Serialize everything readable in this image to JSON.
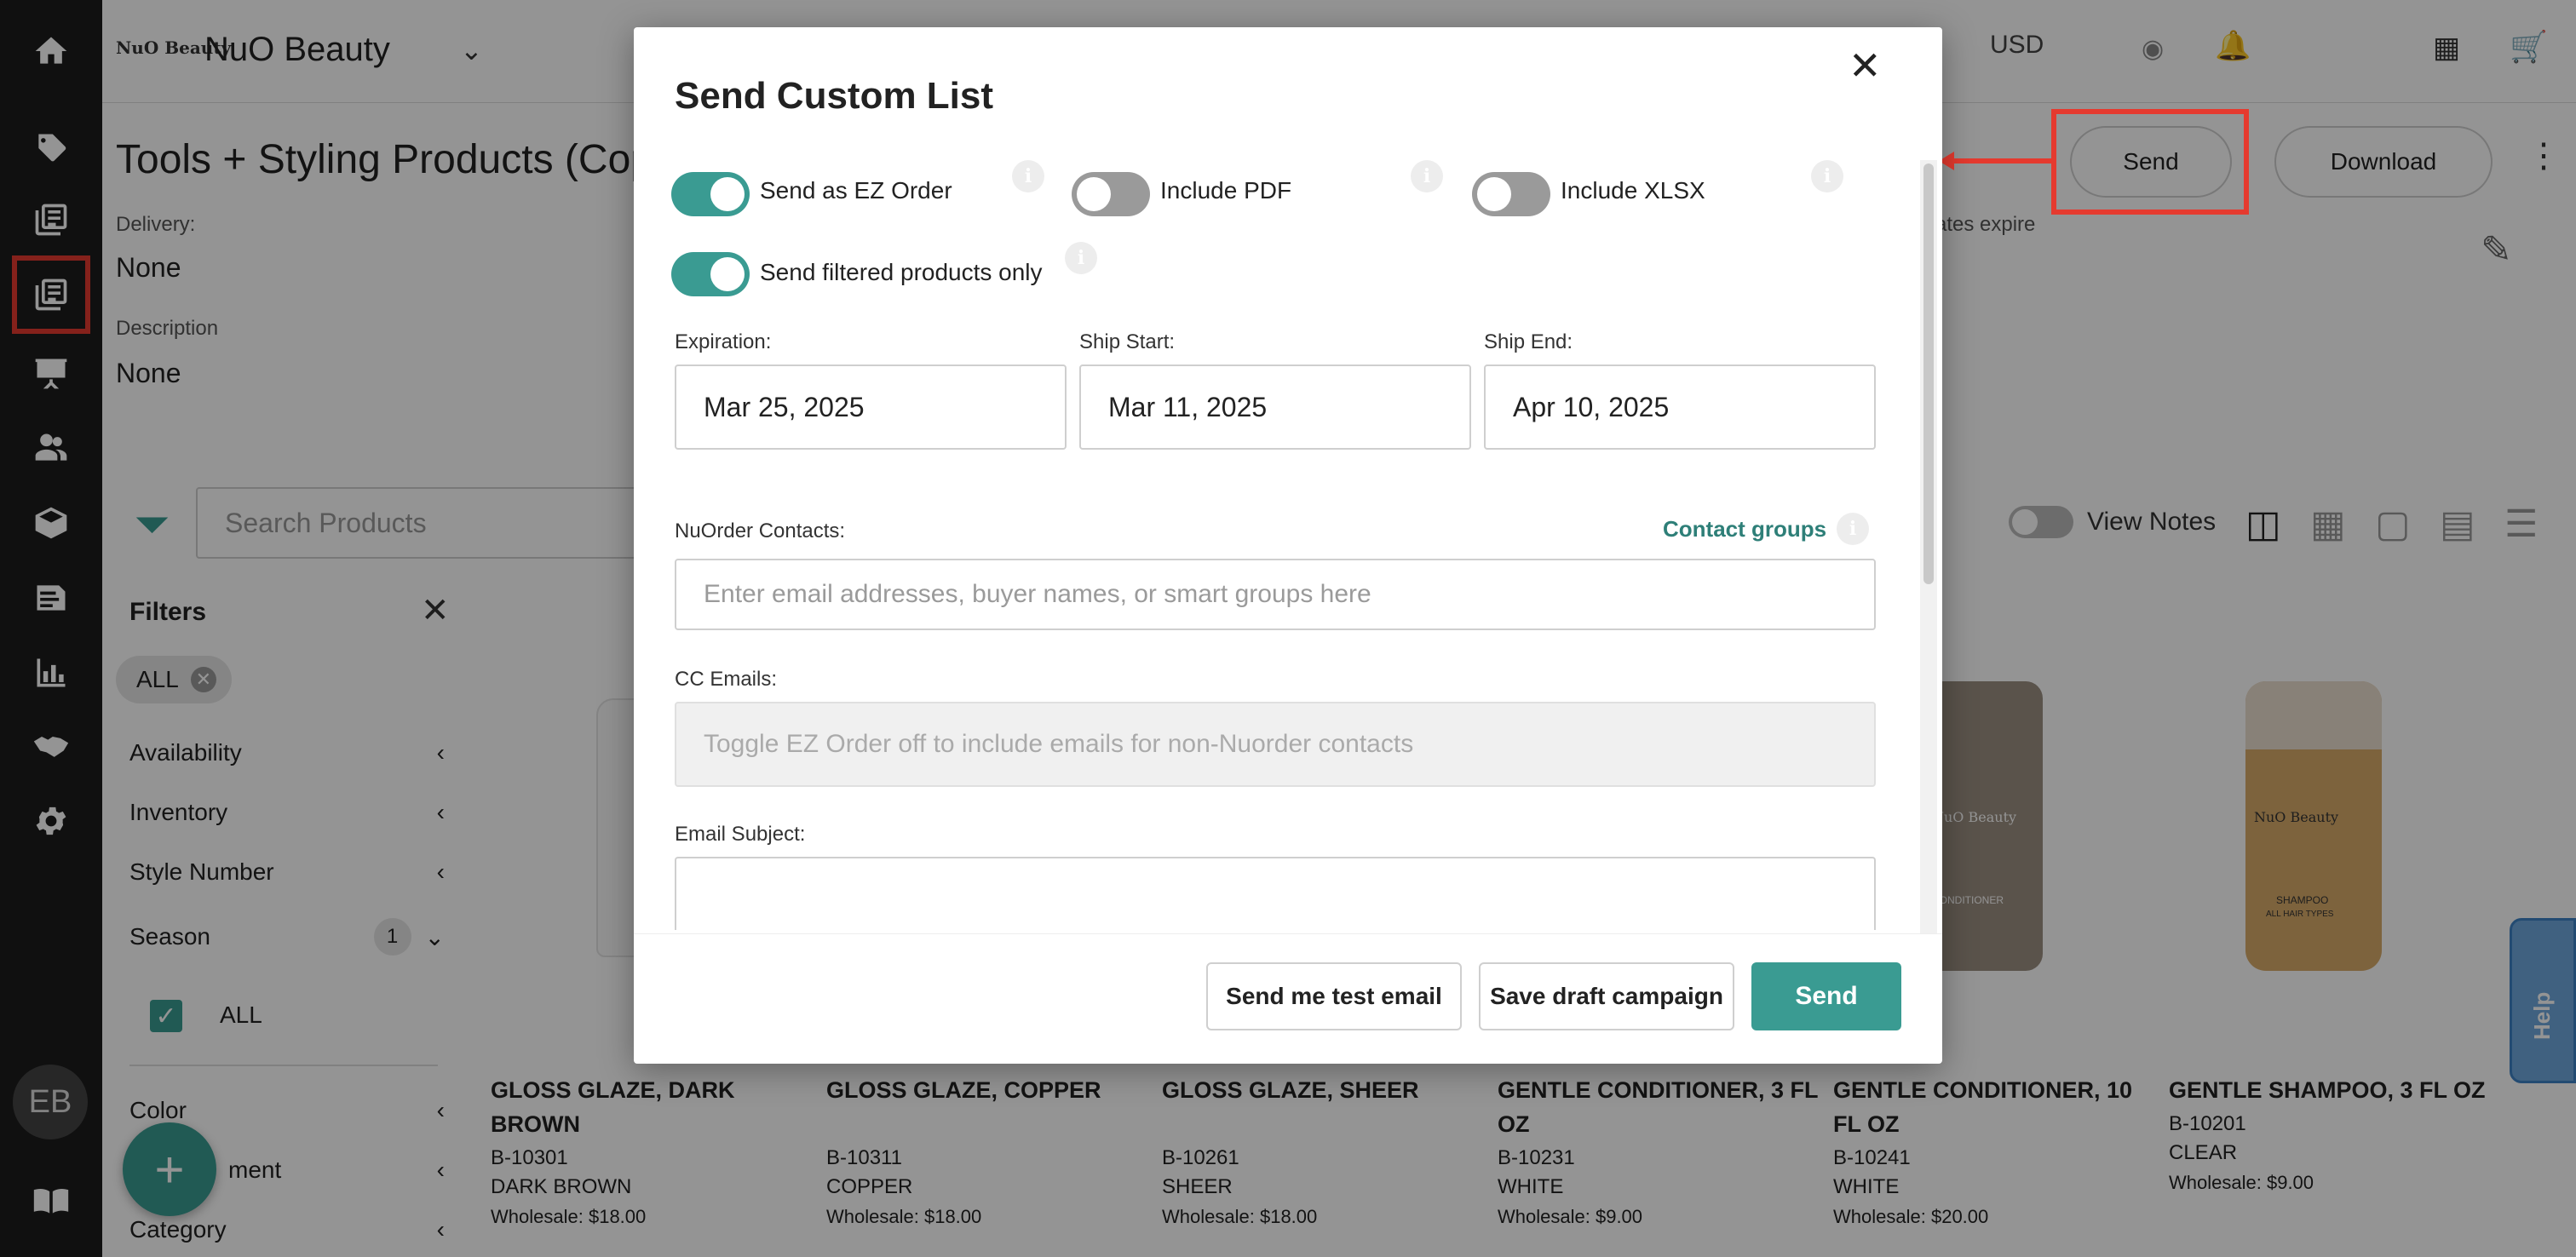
{
  "app": {
    "brand_logo_text": "NuO Beauty",
    "brand_name": "NuO Beauty",
    "currency": "USD",
    "avatar_initials": "EB"
  },
  "page": {
    "title": "Tools + Styling Products (Cop",
    "delivery_label": "Delivery:",
    "delivery_value": "None",
    "description_label": "Description",
    "description_value": "None",
    "right_meta_text": "ates expire",
    "send_label": "Send",
    "download_label": "Download"
  },
  "search": {
    "placeholder": "Search Products"
  },
  "view_notes_label": "View Notes",
  "filters": {
    "title": "Filters",
    "chip": "ALL",
    "items": [
      "Availability",
      "Inventory",
      "Style Number",
      "Season"
    ],
    "season_count": "1",
    "season_option": "ALL",
    "more_items": [
      "Color",
      "ment",
      "Category"
    ]
  },
  "products": [
    {
      "name": "GLOSS GLAZE, DARK BROWN",
      "sku": "B-10301",
      "color": "DARK BROWN",
      "wholesale_label": "Wholesale:",
      "wholesale": "$18.00"
    },
    {
      "name": "GLOSS GLAZE, COPPER",
      "sku": "B-10311",
      "color": "COPPER",
      "wholesale_label": "Wholesale:",
      "wholesale": "$18.00"
    },
    {
      "name": "GLOSS GLAZE, SHEER",
      "sku": "B-10261",
      "color": "SHEER",
      "wholesale_label": "Wholesale:",
      "wholesale": "$18.00"
    },
    {
      "name": "GENTLE CONDITIONER, 3 FL OZ",
      "sku": "B-10231",
      "color": "WHITE",
      "wholesale_label": "Wholesale:",
      "wholesale": "$9.00"
    },
    {
      "name": "GENTLE CONDITIONER, 10 FL OZ",
      "sku": "B-10241",
      "color": "WHITE",
      "wholesale_label": "Wholesale:",
      "wholesale": "$20.00"
    },
    {
      "name": "GENTLE SHAMPOO, 3 FL OZ",
      "sku": "B-10201",
      "color": "CLEAR",
      "wholesale_label": "Wholesale:",
      "wholesale": "$9.00"
    }
  ],
  "product_images": {
    "conditioner_logo": "NuO Beauty",
    "conditioner_label": "CONDITIONER",
    "shampoo_logo": "NuO Beauty",
    "shampoo_label": "SHAMPOO",
    "shampoo_sub": "ALL HAIR TYPES"
  },
  "help_label": "Help",
  "modal": {
    "title": "Send Custom List",
    "toggles": {
      "ez_order": {
        "label": "Send as EZ Order",
        "on": true
      },
      "include_pdf": {
        "label": "Include PDF",
        "on": false
      },
      "include_xlsx": {
        "label": "Include XLSX",
        "on": false
      },
      "filtered_only": {
        "label": "Send filtered products only",
        "on": true
      }
    },
    "info_glyph": "i",
    "expiration_label": "Expiration:",
    "expiration_value": "Mar 25, 2025",
    "ship_start_label": "Ship Start:",
    "ship_start_value": "Mar 11, 2025",
    "ship_end_label": "Ship End:",
    "ship_end_value": "Apr 10, 2025",
    "contacts_label": "NuOrder Contacts:",
    "contact_groups_link": "Contact groups",
    "contacts_placeholder": "Enter email addresses, buyer names, or smart groups here",
    "cc_label": "CC Emails:",
    "cc_placeholder": "Toggle EZ Order off to include emails for non-Nuorder contacts",
    "subject_label": "Email Subject:",
    "subject_value": "",
    "test_email_button": "Send me test email",
    "save_draft_button": "Save draft campaign",
    "send_button": "Send"
  },
  "colors": {
    "accent": "#3a9b92",
    "highlight": "#e53a2f",
    "sidebar": "#1c1c1c"
  }
}
